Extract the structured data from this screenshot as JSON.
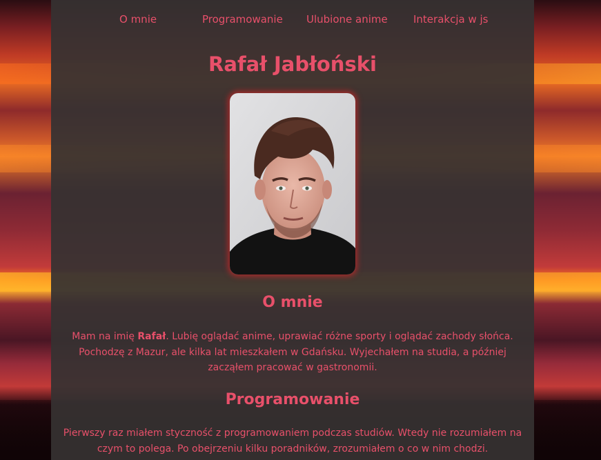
{
  "nav": {
    "items": [
      {
        "label": "O mnie"
      },
      {
        "label": "Programowanie"
      },
      {
        "label": "Ulubione anime"
      },
      {
        "label": "Interakcja w js"
      }
    ]
  },
  "header": {
    "title": "Rafał Jabłoński"
  },
  "profile_photo": {
    "description_icon": "portrait-photo"
  },
  "sections": [
    {
      "title": "O mnie",
      "paragraph": {
        "before_name": "Mam na imię ",
        "name": "Rafał",
        "after_name": ". Lubię oglądać anime, uprawiać różne sporty i oglądać zachody słońca. Pochodzę z Mazur, ale kilka lat mieszkałem w Gdańsku. Wyjechałem na studia, a później zacząłem pracować w gastronomii."
      }
    },
    {
      "title": "Programowanie",
      "paragraph": {
        "text": "Pierwszy raz miałem styczność z programowaniem podczas studiów. Wtedy nie rozumiałem na czym to polega. Po obejrzeniu kilku poradników, zrozumiałem o co w nim chodzi."
      }
    }
  ],
  "colors": {
    "accent": "#e8506a",
    "panel": "#363232",
    "photo_glow": "#b42828"
  }
}
